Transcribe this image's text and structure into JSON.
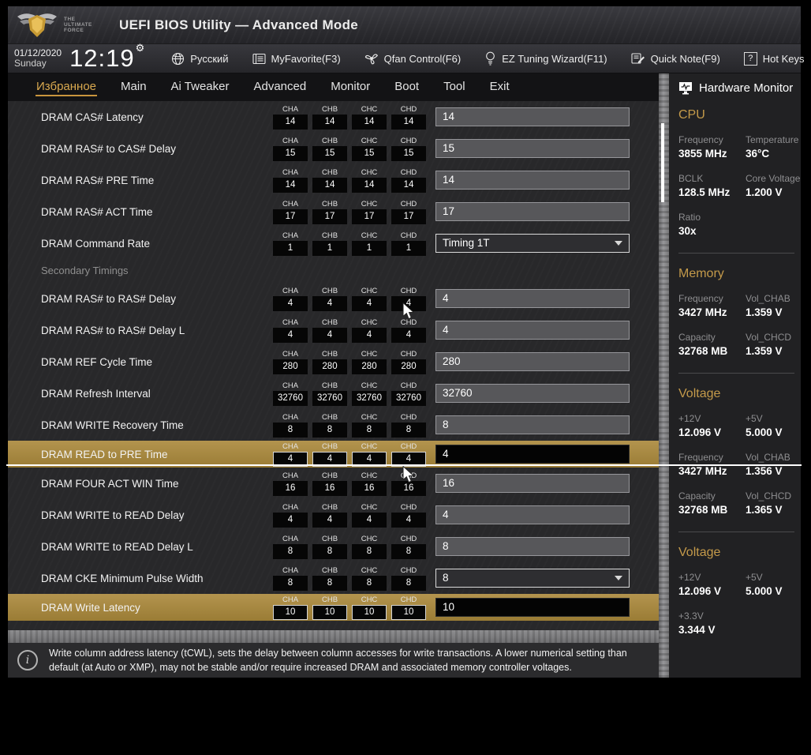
{
  "titlebar": {
    "logo_text": "THE ULTIMATE FORCE",
    "title": "UEFI BIOS Utility — Advanced Mode"
  },
  "toolbar": {
    "date": "01/12/2020",
    "day": "Sunday",
    "time": "12:19",
    "items": [
      {
        "icon": "globe-icon",
        "label": "Русский"
      },
      {
        "icon": "myfavorite-icon",
        "label": "MyFavorite(F3)"
      },
      {
        "icon": "fan-icon",
        "label": "Qfan Control(F6)"
      },
      {
        "icon": "bulb-icon",
        "label": "EZ Tuning Wizard(F11)"
      },
      {
        "icon": "note-icon",
        "label": "Quick Note(F9)"
      },
      {
        "icon": "question-icon",
        "label": "Hot Keys"
      }
    ]
  },
  "nav": {
    "tabs": [
      "Избранное",
      "Main",
      "Ai Tweaker",
      "Advanced",
      "Monitor",
      "Boot",
      "Tool",
      "Exit"
    ],
    "active": "Избранное"
  },
  "channels": [
    "CHA",
    "CHB",
    "CHC",
    "CHD"
  ],
  "settings": {
    "upper": [
      {
        "label": "DRAM CAS# Latency",
        "ch": "14",
        "value": "14",
        "type": "input"
      },
      {
        "label": "DRAM RAS# to CAS# Delay",
        "ch": "15",
        "value": "15",
        "type": "input"
      },
      {
        "label": "DRAM RAS# PRE Time",
        "ch": "14",
        "value": "14",
        "type": "input"
      },
      {
        "label": "DRAM RAS# ACT Time",
        "ch": "17",
        "value": "17",
        "type": "input"
      },
      {
        "label": "DRAM Command Rate",
        "ch": "1",
        "value": "Timing 1T",
        "type": "select"
      },
      {
        "section": "Secondary Timings"
      },
      {
        "label": "DRAM RAS# to RAS# Delay",
        "ch": "4",
        "value": "4",
        "type": "input"
      },
      {
        "label": "DRAM RAS# to RAS# Delay L",
        "ch": "4",
        "value": "4",
        "type": "input"
      },
      {
        "label": "DRAM REF Cycle Time",
        "ch": "280",
        "value": "280",
        "type": "input"
      },
      {
        "label": "DRAM Refresh Interval",
        "ch": "32760",
        "value": "32760",
        "type": "input"
      },
      {
        "label": "DRAM WRITE Recovery Time",
        "ch": "8",
        "value": "8",
        "type": "input"
      },
      {
        "label": "DRAM READ to PRE Time",
        "ch": "4",
        "value": "4",
        "type": "input",
        "highlight": true
      }
    ],
    "lower": [
      {
        "label": "DRAM FOUR ACT WIN Time",
        "ch": "16",
        "value": "16",
        "type": "input"
      },
      {
        "label": "DRAM WRITE to READ Delay",
        "ch": "4",
        "value": "4",
        "type": "input"
      },
      {
        "label": "DRAM WRITE to READ Delay L",
        "ch": "8",
        "value": "8",
        "type": "input"
      },
      {
        "label": "DRAM CKE Minimum Pulse Width",
        "ch": "8",
        "value": "8",
        "type": "select"
      },
      {
        "label": "DRAM Write Latency",
        "ch": "10",
        "value": "10",
        "type": "input",
        "highlight": true
      }
    ]
  },
  "sidebar": {
    "title": "Hardware Monitor",
    "upper": [
      {
        "heading": "CPU",
        "pairs": [
          [
            {
              "label": "Frequency",
              "value": "3855 MHz"
            },
            {
              "label": "Temperature",
              "value": "36°C"
            }
          ],
          [
            {
              "label": "BCLK",
              "value": "128.5 MHz"
            },
            {
              "label": "Core Voltage",
              "value": "1.200 V"
            }
          ],
          [
            {
              "label": "Ratio",
              "value": "30x"
            }
          ]
        ]
      },
      {
        "heading": "Memory",
        "pairs": [
          [
            {
              "label": "Frequency",
              "value": "3427 MHz"
            },
            {
              "label": "Vol_CHAB",
              "value": "1.359 V"
            }
          ],
          [
            {
              "label": "Capacity",
              "value": "32768 MB"
            },
            {
              "label": "Vol_CHCD",
              "value": "1.359 V"
            }
          ]
        ]
      },
      {
        "heading": "Voltage",
        "pairs": [
          [
            {
              "label": "+12V",
              "value": "12.096 V"
            },
            {
              "label": "+5V",
              "value": "5.000 V"
            }
          ]
        ]
      }
    ],
    "lower": [
      {
        "heading": "",
        "pairs": [
          [
            {
              "label": "Frequency",
              "value": "3427 MHz"
            },
            {
              "label": "Vol_CHAB",
              "value": "1.356 V"
            }
          ],
          [
            {
              "label": "Capacity",
              "value": "32768 MB"
            },
            {
              "label": "Vol_CHCD",
              "value": "1.365 V"
            }
          ]
        ]
      },
      {
        "heading": "Voltage",
        "pairs": [
          [
            {
              "label": "+12V",
              "value": "12.096 V"
            },
            {
              "label": "+5V",
              "value": "5.000 V"
            }
          ],
          [
            {
              "label": "+3.3V",
              "value": "3.344 V"
            }
          ]
        ]
      }
    ]
  },
  "info": {
    "line1": "Write column address latency (tCWL), sets the delay between column accesses for write transactions. A lower numerical setting than",
    "line2": "default (at Auto or XMP), may not be stable and/or require increased DRAM and associated memory controller voltages."
  }
}
